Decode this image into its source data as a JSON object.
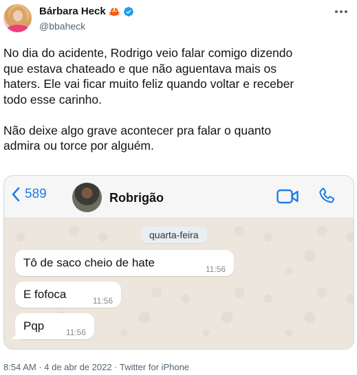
{
  "author": {
    "name": "Bárbara Heck",
    "emoji": "🦀",
    "handle": "@bbaheck"
  },
  "tweet": {
    "text": "No dia do acidente, Rodrigo veio falar comigo dizendo\nque estava chateado e que não aguentava mais os\nhaters. Ele vai ficar muito feliz quando voltar e receber\ntodo esse carinho.\n\nNão deixe algo grave acontecer pra falar o quanto\nadmira ou torce por alguém."
  },
  "screenshot": {
    "back_count": "589",
    "contact_name": "Robrigão",
    "day_label": "quarta-feira",
    "messages": [
      {
        "text": "Tô de saco cheio de hate",
        "time": "11:56"
      },
      {
        "text": "E fofoca",
        "time": "11:56"
      },
      {
        "text": "Pqp",
        "time": "11:56"
      }
    ]
  },
  "meta": {
    "footer": "8:54 AM · 4 de abr de 2022 · Twitter for iPhone"
  },
  "colors": {
    "verified": "#1d9bf0",
    "link_blue": "#1c7ee6",
    "secondary_text": "#536471"
  },
  "icons": [
    "avatar",
    "crab-emoji",
    "verified-badge-icon",
    "more-icon",
    "chevron-left-icon",
    "video-call-icon",
    "phone-call-icon"
  ]
}
